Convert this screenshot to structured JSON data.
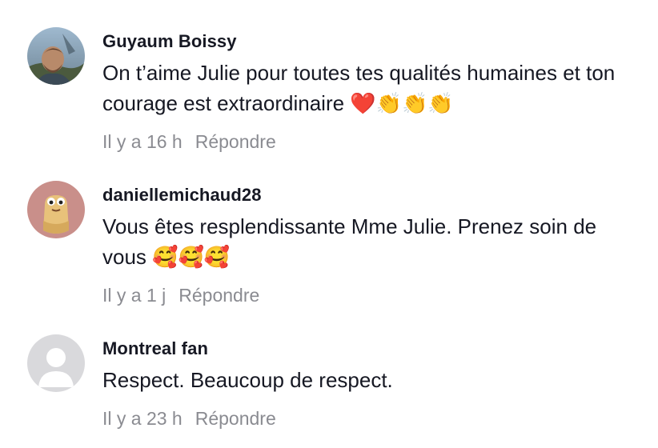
{
  "comments": [
    {
      "username": "Guyaum Boissy",
      "text": "On t’aime Julie pour toutes tes qualités humaines et ton courage est extraordinaire ❤️👏👏👏",
      "time": "Il y a 16 h",
      "reply_label": "Répondre",
      "avatar_icon": "profile-photo"
    },
    {
      "username": "daniellemichaud28",
      "text": "Vous êtes resplendissante Mme Julie. Prenez soin de vous 🥰🥰🥰",
      "time": "Il y a 1 j",
      "reply_label": "Répondre",
      "avatar_icon": "cartoon-avatar"
    },
    {
      "username": "Montreal fan",
      "text": "Respect. Beaucoup de respect.",
      "time": "Il y a 23 h",
      "reply_label": "Répondre",
      "avatar_icon": "default-user-icon"
    }
  ],
  "colors": {
    "text": "#161823",
    "meta": "#8a8b91",
    "default_avatar_bg": "#d9d9dc",
    "cartoon_avatar_bg": "#c98f8a"
  }
}
